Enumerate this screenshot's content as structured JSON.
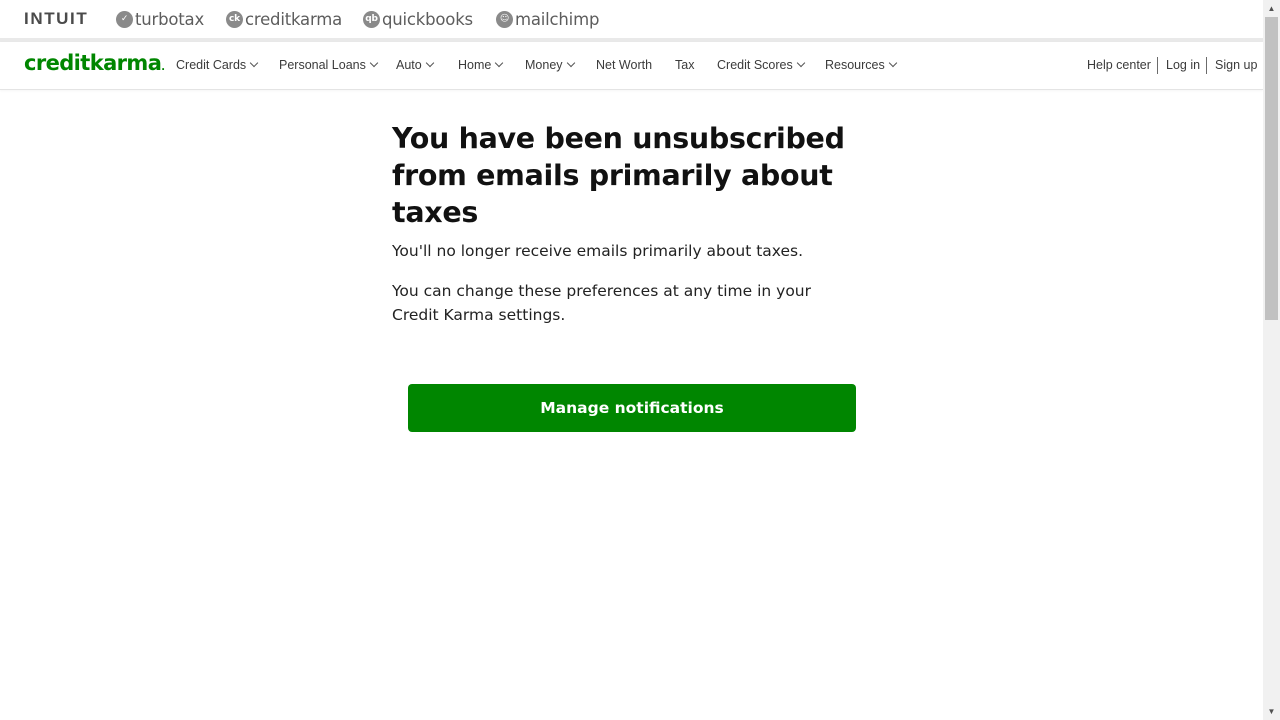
{
  "brandbar": {
    "intuit": "INTUIT",
    "products": [
      {
        "name": "turbotax",
        "icon": "✓"
      },
      {
        "name": "creditkarma",
        "icon": "ck"
      },
      {
        "name": "quickbooks",
        "icon": "qb"
      },
      {
        "name": "mailchimp",
        "icon": "☺"
      }
    ]
  },
  "nav": {
    "logo": "creditkarma",
    "logo_dot": ".",
    "items": [
      {
        "label": "Credit Cards"
      },
      {
        "label": "Personal Loans"
      },
      {
        "label": "Auto"
      },
      {
        "label": "Home"
      },
      {
        "label": "Money"
      },
      {
        "label": "Net Worth"
      },
      {
        "label": "Tax"
      },
      {
        "label": "Credit Scores"
      },
      {
        "label": "Resources"
      }
    ],
    "help_center": "Help center",
    "log_in": "Log in",
    "sign_up": "Sign up"
  },
  "main": {
    "heading": "You have been unsubscribed from emails primarily about taxes",
    "para1": "You'll no longer receive emails primarily about taxes.",
    "para2": "You can change these preferences at any time in your Credit Karma settings.",
    "button": "Manage notifications"
  },
  "colors": {
    "brand_green": "#008600",
    "text": "#111111"
  }
}
